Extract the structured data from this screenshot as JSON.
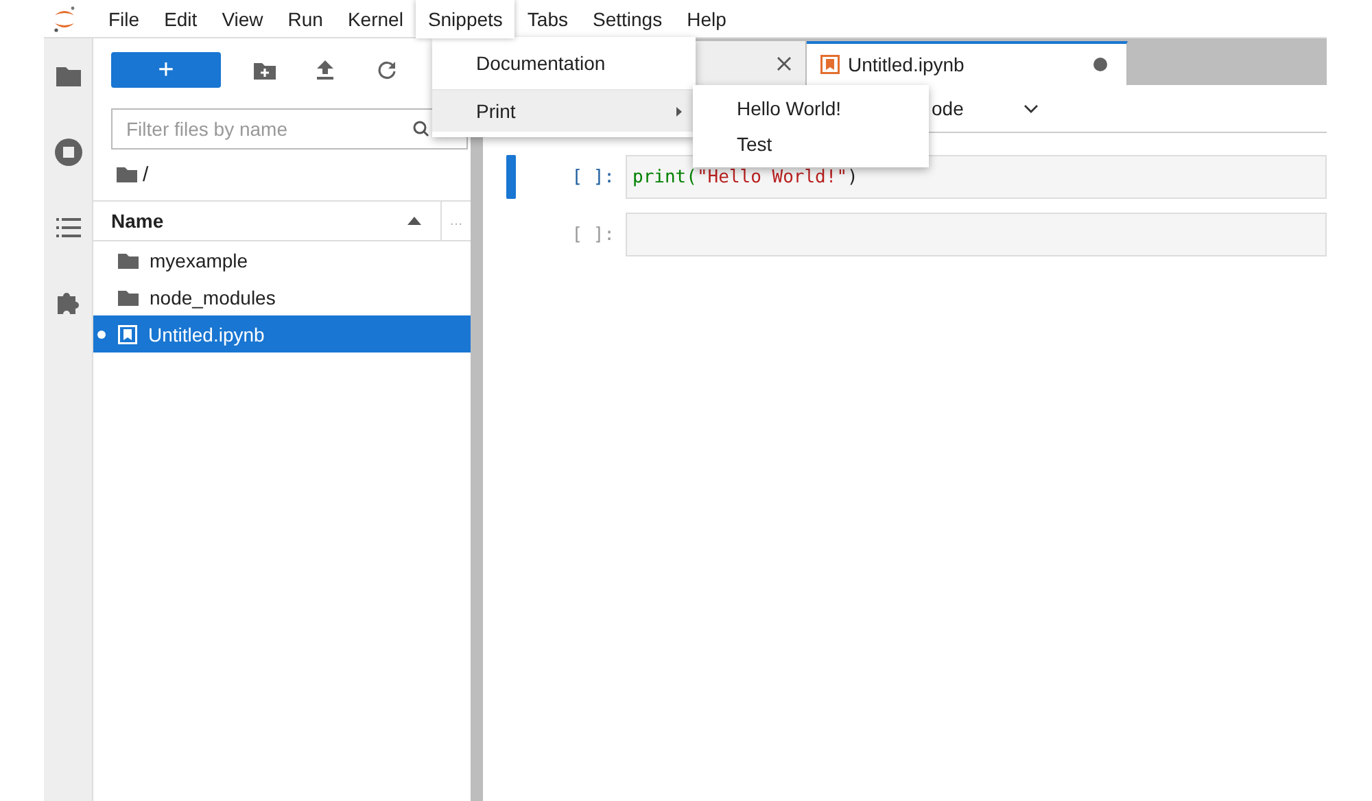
{
  "menubar": [
    {
      "label": "File",
      "selected": false
    },
    {
      "label": "Edit",
      "selected": false
    },
    {
      "label": "View",
      "selected": false
    },
    {
      "label": "Run",
      "selected": false
    },
    {
      "label": "Kernel",
      "selected": false
    },
    {
      "label": "Snippets",
      "selected": true
    },
    {
      "label": "Tabs",
      "selected": false
    },
    {
      "label": "Settings",
      "selected": false
    },
    {
      "label": "Help",
      "selected": false
    }
  ],
  "snippets_menu": {
    "items": [
      {
        "label": "Documentation",
        "kind": "item",
        "selected": false
      },
      {
        "label": "Print",
        "kind": "submenu",
        "selected": true
      }
    ],
    "submenu": [
      {
        "label": "Hello World!"
      },
      {
        "label": "Test"
      }
    ]
  },
  "file_browser": {
    "new_button": "+",
    "filter": {
      "placeholder": "Filter files by name"
    },
    "path": "/",
    "columns": [
      {
        "label": "Name",
        "sorted": true
      },
      {
        "label": "..."
      }
    ],
    "rows": [
      {
        "name": "myexample",
        "kind": "folder",
        "selected": false,
        "running": false
      },
      {
        "name": "node_modules",
        "kind": "folder",
        "selected": false,
        "running": false
      },
      {
        "name": "Untitled.ipynb",
        "kind": "notebook",
        "selected": true,
        "running": true
      }
    ]
  },
  "tabs": [
    {
      "selected": false,
      "dirty": false
    },
    {
      "label": "Untitled.ipynb",
      "selected": true,
      "dirty": true
    }
  ],
  "notebook": {
    "cell_type": "ode",
    "cells": [
      {
        "prompt": "[ ]:",
        "code": "print(",
        "string": "\"Hello World!\"",
        "close": ")",
        "active": true
      },
      {
        "prompt": "[ ]:",
        "active": false
      }
    ]
  }
}
